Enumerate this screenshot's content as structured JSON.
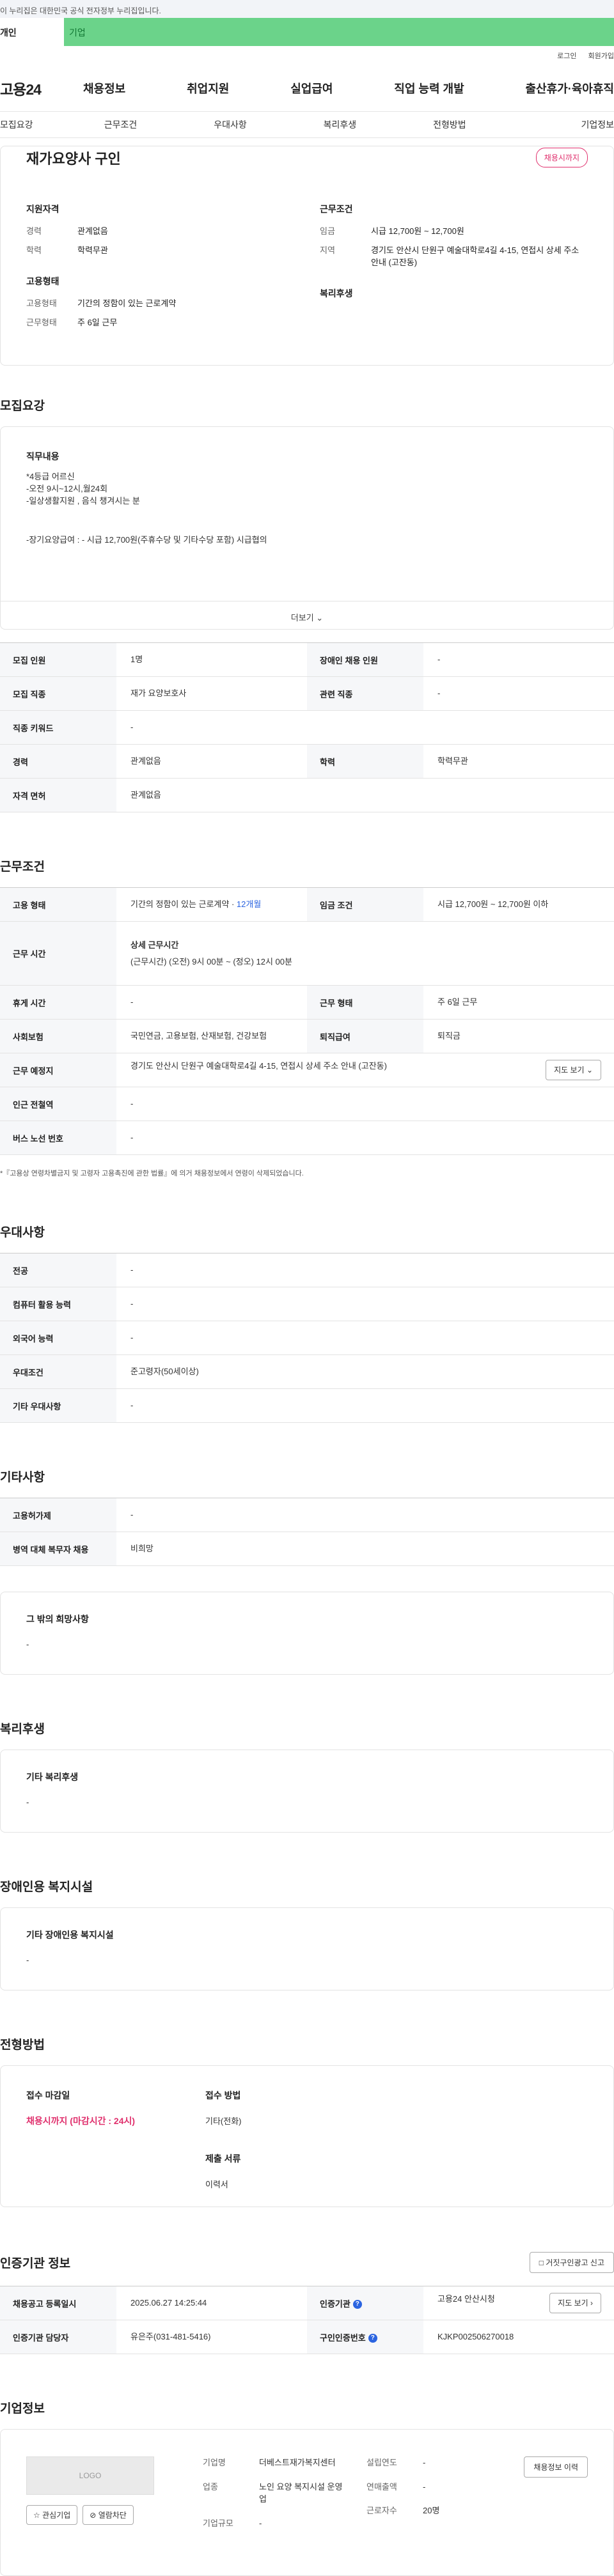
{
  "gov_banner": "이 누리집은 대한민국 공식 전자정부 누리집입니다.",
  "type_tabs": {
    "person": "개인",
    "company": "기업"
  },
  "util": {
    "login": "로그인",
    "signup": "회원가입"
  },
  "gnb": {
    "logo": "고용24",
    "menu": [
      "채용정보",
      "취업지원",
      "실업급여",
      "직업 능력 개발",
      "출산휴가·육아휴직"
    ]
  },
  "anchor_nav": [
    "모집요강",
    "근무조건",
    "우대사항",
    "복리후생",
    "전형방법",
    "기업정보"
  ],
  "summary": {
    "title": "재가요양사 구인",
    "badge": "채용시까지",
    "qual_title": "지원자격",
    "qual": [
      {
        "k": "경력",
        "v": "관계없음"
      },
      {
        "k": "학력",
        "v": "학력무관"
      }
    ],
    "emp_title": "고용형태",
    "emp": [
      {
        "k": "고용형태",
        "v": "기간의 정함이 있는 근로계약"
      },
      {
        "k": "근무형태",
        "v": "주 6일 근무"
      }
    ],
    "cond_title": "근무조건",
    "cond": [
      {
        "k": "임금",
        "v": "시급 12,700원 ~ 12,700원"
      },
      {
        "k": "지역",
        "v": "경기도 안산시 단원구 예술대학로4길 4-15, 연접시 상세 주소 안내 (고잔동)"
      }
    ],
    "welfare_title": "복리후생"
  },
  "recruit": {
    "section_title": "모집요강",
    "duty_title": "직무내용",
    "duty_lines": [
      "*4등급 어르신",
      "-오전 9시~12시,월24회",
      "-일상생활지원 , 음식 챙겨시는 분"
    ],
    "duty_wage_line": "-장기요양급여 : - 시급 12,700원(주휴수당 및 기타수당 포함) 시급협의",
    "more": "더보기",
    "rows": [
      {
        "k1": "모집 인원",
        "v1": "1명",
        "k2": "장애인 채용 인원",
        "v2": "-"
      },
      {
        "k1": "모집 직종",
        "v1": "재가 요양보호사",
        "k2": "관련 직종",
        "v2": "-"
      },
      {
        "k1": "직종 키워드",
        "v1": "-"
      },
      {
        "k1": "경력",
        "v1": "관계없음",
        "k2": "학력",
        "v2": "학력무관"
      },
      {
        "k1": "자격 면허",
        "v1": "관계없음"
      }
    ]
  },
  "work": {
    "section_title": "근무조건",
    "emp_type_label": "고용 형태",
    "emp_type_value": "기간의 정함이 있는 근로계약 · ",
    "emp_type_period": "12개월",
    "wage_label": "임금 조건",
    "wage_value": "시급 12,700원 ~ 12,700원 이하",
    "hours_label": "근무 시간",
    "hours_title": "상세 근무시간",
    "hours_value": "(근무시간) (오전) 9시 00분 ~ (정오) 12시 00분",
    "holiday_label": "휴게 시간",
    "holiday_value": "-",
    "worktype_label": "근무 형태",
    "worktype_value": "주 6일 근무",
    "insurance_label": "사회보험",
    "insurance_value": "국민연금, 고용보험, 산재보험, 건강보험",
    "retire_label": "퇴직급여",
    "retire_value": "퇴직금",
    "place_label": "근무 예정지",
    "place_value": "경기도 안산시 단원구 예술대학로4길 4-15, 연접시 상세 주소 안내 (고잔동)",
    "map_btn": "지도 보기",
    "subway_label": "인근 전철역",
    "subway_value": "-",
    "bus_label": "버스 노선 번호",
    "bus_value": "-",
    "note": "*『고용상 연령차별금지 및 고령자 고용촉진에 관한 법률』에 의거 채용정보에서 연령이 삭제되었습니다."
  },
  "pref": {
    "section_title": "우대사항",
    "rows": [
      {
        "k": "전공",
        "v": "-"
      },
      {
        "k": "컴퓨터 활용 능력",
        "v": "-"
      },
      {
        "k": "외국어 능력",
        "v": "-"
      },
      {
        "k": "우대조건",
        "v": "준고령자(50세이상)"
      },
      {
        "k": "기타 우대사항",
        "v": "-"
      }
    ]
  },
  "etc": {
    "section_title": "기타사항",
    "rows": [
      {
        "k": "고용허가제",
        "v": "-"
      },
      {
        "k": "병역 대체 복무자 채용",
        "v": "비희망"
      }
    ],
    "other_title": "그 밖의 희망사항",
    "other_value": "-"
  },
  "welfare": {
    "section_title": "복리후생",
    "card_title": "기타 복리후생",
    "card_value": "-"
  },
  "disability": {
    "section_title": "장애인용 복지시설",
    "card_title": "기타 장애인용 복지시설",
    "card_value": "-"
  },
  "selection": {
    "section_title": "전형방법",
    "deadline_title": "접수 마감일",
    "deadline_value": "채용시까지 (마감시간 : 24시)",
    "method_title": "접수 방법",
    "method_value": "기타(전화)",
    "docs_title": "제출 서류",
    "docs_value": "이력서"
  },
  "cert": {
    "section_title": "인증기관 정보",
    "report_btn": "거짓구인광고 신고",
    "reg_label": "채용공고 등록일시",
    "reg_value": "2025.06.27 14:25:44",
    "org_label": "인증기관",
    "org_value": "고용24 안산시청",
    "map_btn": "지도 보기",
    "manager_label": "인증기관 담당자",
    "manager_value": "유은주(031-481-5416)",
    "job_no_label": "구인인증번호",
    "job_no_value": "KJKP002506270018"
  },
  "company": {
    "section_title": "기업정보",
    "logo_text": "LOGO",
    "fav_btn": "관심기업",
    "block_btn": "열람차단",
    "history_btn": "채용정보 이력",
    "name_label": "기업명",
    "name_value": "더베스트재가복지센터",
    "industry_label": "업종",
    "industry_value": "노인 요양 복지시설 운영업",
    "size_label": "기업규모",
    "size_value": "-",
    "founded_label": "설립연도",
    "founded_value": "-",
    "sales_label": "연매출액",
    "sales_value": "-",
    "employees_label": "근로자수",
    "employees_value": "20명"
  }
}
